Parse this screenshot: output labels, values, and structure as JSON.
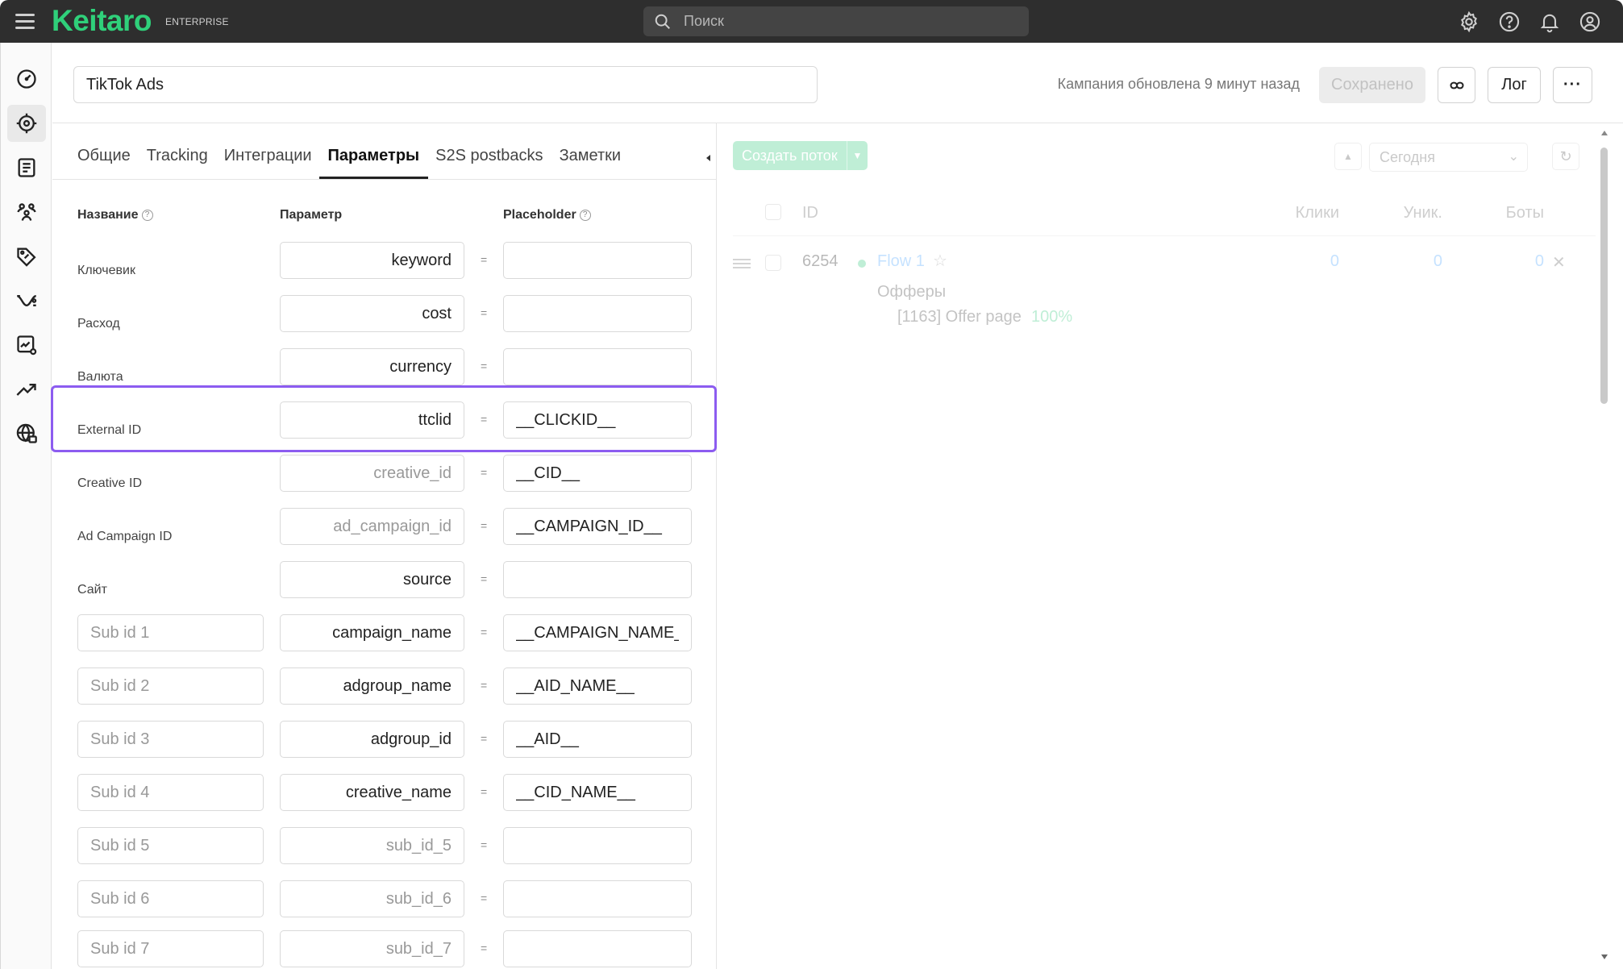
{
  "app": {
    "logo": "Keitaro",
    "edition": "ENTERPRISE",
    "search_placeholder": "Поиск"
  },
  "colors": {
    "brand": "#2fd07a",
    "topbar": "#2e2e2e",
    "highlight": "#8c5cf0",
    "link": "#4aa3ff"
  },
  "topbar_icons": [
    "gear-icon",
    "help-icon",
    "bell-icon",
    "user-icon"
  ],
  "rail": [
    "dashboard-icon",
    "campaigns-icon",
    "landing-pages-icon",
    "affiliate-networks-icon",
    "offers-icon",
    "streams-icon",
    "reports-settings-icon",
    "trends-icon",
    "geo-icon"
  ],
  "header": {
    "campaign_name": "TikTok Ads",
    "updated": "Кампания обновлена 9 минут назад",
    "saved_label": "Сохранено",
    "log_label": "Лог",
    "more_label": "···"
  },
  "tabs": [
    "Общие",
    "Tracking",
    "Интеграции",
    "Параметры",
    "S2S postbacks",
    "Заметки"
  ],
  "active_tab": "Параметры",
  "columns": {
    "name": "Название",
    "param": "Параметр",
    "placeholder": "Placeholder"
  },
  "params": [
    {
      "label": "Ключевик",
      "param": "keyword",
      "placeholder": ""
    },
    {
      "label": "Расход",
      "param": "cost",
      "placeholder": ""
    },
    {
      "label": "Валюта",
      "param": "currency",
      "placeholder": ""
    },
    {
      "label": "External ID",
      "param": "ttclid",
      "placeholder": "__CLICKID__"
    },
    {
      "label": "Creative ID",
      "param_placeholder": "creative_id",
      "placeholder": "__CID__"
    },
    {
      "label": "Ad Campaign ID",
      "param_placeholder": "ad_campaign_id",
      "placeholder": "__CAMPAIGN_ID__"
    },
    {
      "label": "Сайт",
      "param": "source",
      "placeholder": ""
    },
    {
      "sub_placeholder": "Sub id 1",
      "param": "campaign_name",
      "placeholder": "__CAMPAIGN_NAME__"
    },
    {
      "sub_placeholder": "Sub id 2",
      "param": "adgroup_name",
      "placeholder": "__AID_NAME__"
    },
    {
      "sub_placeholder": "Sub id 3",
      "param": "adgroup_id",
      "placeholder": "__AID__"
    },
    {
      "sub_placeholder": "Sub id 4",
      "param": "creative_name",
      "placeholder": "__CID_NAME__"
    },
    {
      "sub_placeholder": "Sub id 5",
      "param_placeholder": "sub_id_5",
      "placeholder": ""
    },
    {
      "sub_placeholder": "Sub id 6",
      "param_placeholder": "sub_id_6",
      "placeholder": ""
    },
    {
      "sub_placeholder": "Sub id 7",
      "param_placeholder": "sub_id_7",
      "placeholder": ""
    }
  ],
  "equals": "=",
  "flows": {
    "create_label": "Создать поток",
    "period": "Сегодня",
    "headers": {
      "id": "ID",
      "clicks": "Клики",
      "unique": "Уник.",
      "bots": "Боты"
    },
    "row": {
      "id": "6254",
      "name": "Flow 1",
      "clicks": "0",
      "unique": "0",
      "bots": "0",
      "offers_title": "Офферы",
      "offer": "[1163] Offer page",
      "share": "100%"
    }
  }
}
